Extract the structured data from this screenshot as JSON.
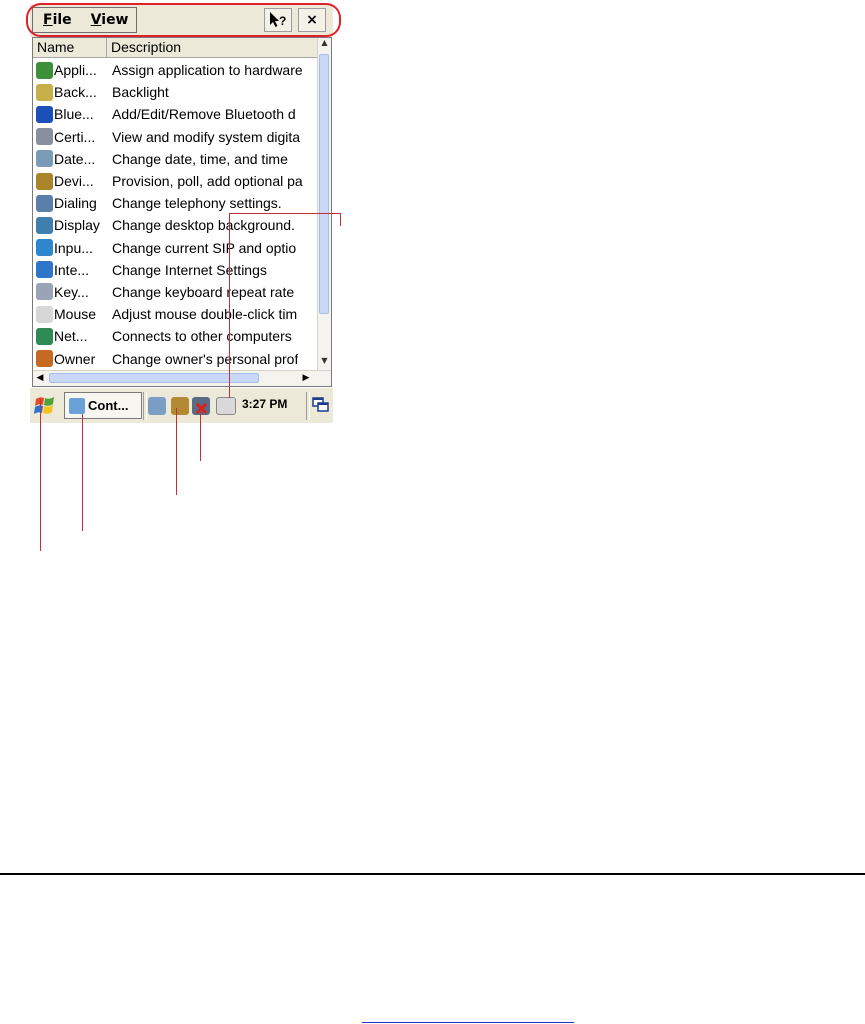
{
  "menu": {
    "file": "File",
    "file_accel": "F",
    "view": "View",
    "view_accel": "V"
  },
  "toolbar": {
    "help": "?",
    "close": "×"
  },
  "columns": {
    "name": "Name",
    "description": "Description"
  },
  "items": [
    {
      "name": "Appli...",
      "description": "Assign application to hardware",
      "icon": "hardware-buttons-icon",
      "color": "#3d8f3a"
    },
    {
      "name": "Back...",
      "description": "Backlight",
      "icon": "backlight-icon",
      "color": "#c7b04a"
    },
    {
      "name": "Blue...",
      "description": "Add/Edit/Remove Bluetooth d",
      "icon": "bluetooth-icon",
      "color": "#1c4fb8"
    },
    {
      "name": "Certi...",
      "description": "View and modify system digita",
      "icon": "certificates-icon",
      "color": "#8a8fa0"
    },
    {
      "name": "Date...",
      "description": "Change date, time, and time",
      "icon": "date-time-icon",
      "color": "#7a9ab8"
    },
    {
      "name": "Devi...",
      "description": "Provision, poll, add optional pa",
      "icon": "device-management-icon",
      "color": "#a8842a"
    },
    {
      "name": "Dialing",
      "description": "Change telephony settings.",
      "icon": "dialing-icon",
      "color": "#5b7fa8"
    },
    {
      "name": "Display",
      "description": "Change desktop background.",
      "icon": "display-icon",
      "color": "#3f7fb0"
    },
    {
      "name": "Inpu...",
      "description": "Change current SIP and optio",
      "icon": "input-panel-icon",
      "color": "#2e86cc"
    },
    {
      "name": "Inte...",
      "description": "Change Internet Settings",
      "icon": "internet-options-icon",
      "color": "#2f76c9"
    },
    {
      "name": "Key...",
      "description": "Change keyboard repeat rate",
      "icon": "keyboard-icon",
      "color": "#9ba3b6"
    },
    {
      "name": "Mouse",
      "description": "Adjust mouse double-click tim",
      "icon": "mouse-icon",
      "color": "#d7d7d7"
    },
    {
      "name": "Net...",
      "description": "Connects to other computers",
      "icon": "network-icon",
      "color": "#2f8a55"
    },
    {
      "name": "Owner",
      "description": "Change owner's personal prof",
      "icon": "owner-icon",
      "color": "#c46a22"
    }
  ],
  "taskbar": {
    "task_label": "Cont...",
    "clock": "3:27 PM"
  }
}
